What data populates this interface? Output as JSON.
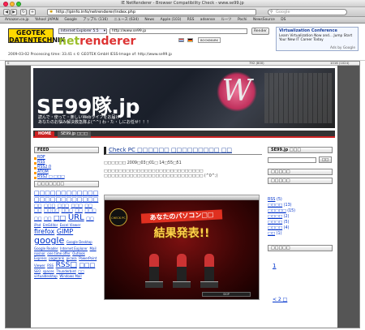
{
  "window": {
    "title": "IE NetRenderer - Browser Compatibility Check - www.se99.jp"
  },
  "toolbar": {
    "url": "http://ipinfo.info/netrenderer/index.php",
    "search_placeholder": "Google"
  },
  "bookmarks": [
    "Amazon.co.jp",
    "Yahoo! JAPAN",
    "Google",
    "アップル (116)",
    "ニュース (634)",
    "News",
    "Apple (103)",
    "RSS",
    "adsense",
    "ルーツ",
    "Pochi",
    "NewsSource",
    "DS"
  ],
  "netrenderer": {
    "geotek": "GEOTEK DATENTECHNIK",
    "logo_net": "net",
    "logo_renderer": "renderer",
    "browser_select": "Internet Explorer 5.5",
    "url_value": "http://www.se99.jp",
    "render_button": "Render",
    "bookmark_label": "BOOKMARK",
    "info": "2009-03-02   Processing time: 33.41 s  © GEOTEK GmbH   IESS-Image of: http://www.se99.jp",
    "ruler_left": "0",
    "ruler_mid": "792 (800)",
    "ruler_right": "1016 (1024)"
  },
  "ad": {
    "title": "Virtualization Conference",
    "text": "Learn Virtualization Now and... Jump Start Your New IT Career Today",
    "by": "Ads by Google"
  },
  "site": {
    "banner_title": "SE99隊.jp",
    "banner_sub_line1": "読んで・使って・楽しいWebライフをお届け！",
    "banner_sub_line2": "あなたのお悩み解決救急隊よ(^^) わ・た・しにお任せ！！！",
    "banner_logo": "W",
    "nav_home": "HOME",
    "nav_about": "SE99.jp □□□",
    "feed_head": "FEED",
    "feed_links": [
      "RDF",
      "RSS",
      "RSS2.0",
      "ATOM",
      "RSS2 □ □□□"
    ],
    "tags_head": "□□□□□□□",
    "tags": [
      {
        "t": "□□□□□□□□□□□□",
        "s": 7
      },
      {
        "t": "□□□□□□□□□□□□",
        "s": 7
      },
      {
        "t": "□□",
        "s": 5
      },
      {
        "t": "□□□",
        "s": 5
      },
      {
        "t": "□□□",
        "s": 5
      },
      {
        "t": "□□□",
        "s": 5
      },
      {
        "t": "□□",
        "s": 5
      },
      {
        "t": "□□",
        "s": 5
      },
      {
        "t": "□□□□",
        "s": 5
      },
      {
        "t": "□□□",
        "s": 5
      },
      {
        "t": "□□",
        "s": 5
      },
      {
        "t": "□□□",
        "s": 5
      },
      {
        "t": "□□",
        "s": 5
      },
      {
        "t": "□□",
        "s": 5
      },
      {
        "t": "□□",
        "s": 8
      },
      {
        "t": "URL",
        "s": 10
      },
      {
        "t": "□□",
        "s": 5
      },
      {
        "t": "iPod",
        "s": 4
      },
      {
        "t": "EmEditor",
        "s": 4
      },
      {
        "t": "Excel Viewer",
        "s": 4
      },
      {
        "t": "firefox",
        "s": 8
      },
      {
        "t": "GIMP",
        "s": 8
      },
      {
        "t": "google",
        "s": 11
      },
      {
        "t": "Google Desktop",
        "s": 4
      },
      {
        "t": "Google Reader",
        "s": 4
      },
      {
        "t": "Internet Explorer",
        "s": 4
      },
      {
        "t": "Mail",
        "s": 4
      },
      {
        "t": "nosnor",
        "s": 4
      },
      {
        "t": "one time offer",
        "s": 4
      },
      {
        "t": "Outlook Express",
        "s": 4
      },
      {
        "t": "pagerank",
        "s": 4
      },
      {
        "t": "picasa",
        "s": 4
      },
      {
        "t": "PowerPoint Viewer",
        "s": 4
      },
      {
        "t": "RSS",
        "s": 4
      },
      {
        "t": "RSS□",
        "s": 9
      },
      {
        "t": "□□□",
        "s": 7
      },
      {
        "t": "SEO",
        "s": 4
      },
      {
        "t": "spaces",
        "s": 4
      },
      {
        "t": "Thunderbird",
        "s": 4
      },
      {
        "t": "□□",
        "s": 4
      },
      {
        "t": "virtualdesktop",
        "s": 4
      },
      {
        "t": "Windows Mail",
        "s": 4
      }
    ],
    "post_title": "Check PC □□□□□□ □□□□□□□□□ □□",
    "post_meta": "□□□□□□ 2009□03□01□ 14□55□51",
    "post_body": "□□□□□□□□□□□□□□□□□□□□□□□□□□□ □□□□□□□□□□□□□□□□□□□□□□□□□□□ (^0^;)",
    "shot_logo": "CHECK PC",
    "shot_caption1": "あなたのパソコン□□",
    "shot_caption2": "結果発表!!",
    "shot_controls": "SKIP",
    "right_head": "SE99.jp □□□",
    "search_button": "□□",
    "cat_head": "□□□□□",
    "tag_head2": "□□□□□",
    "categories": [
      {
        "label": "RSS",
        "count": "(5)"
      },
      {
        "label": "□□□□",
        "count": "(13)"
      },
      {
        "label": "□□□□□",
        "count": "(15)"
      },
      {
        "label": "□□□□",
        "count": "(2)"
      },
      {
        "label": "□□□□",
        "count": "(5)"
      },
      {
        "label": "□□□□",
        "count": "(4)"
      },
      {
        "label": "□□",
        "count": "(1)"
      }
    ],
    "cal_head": "□□□□□",
    "cal_num": "1",
    "prev": "< 2 □"
  }
}
